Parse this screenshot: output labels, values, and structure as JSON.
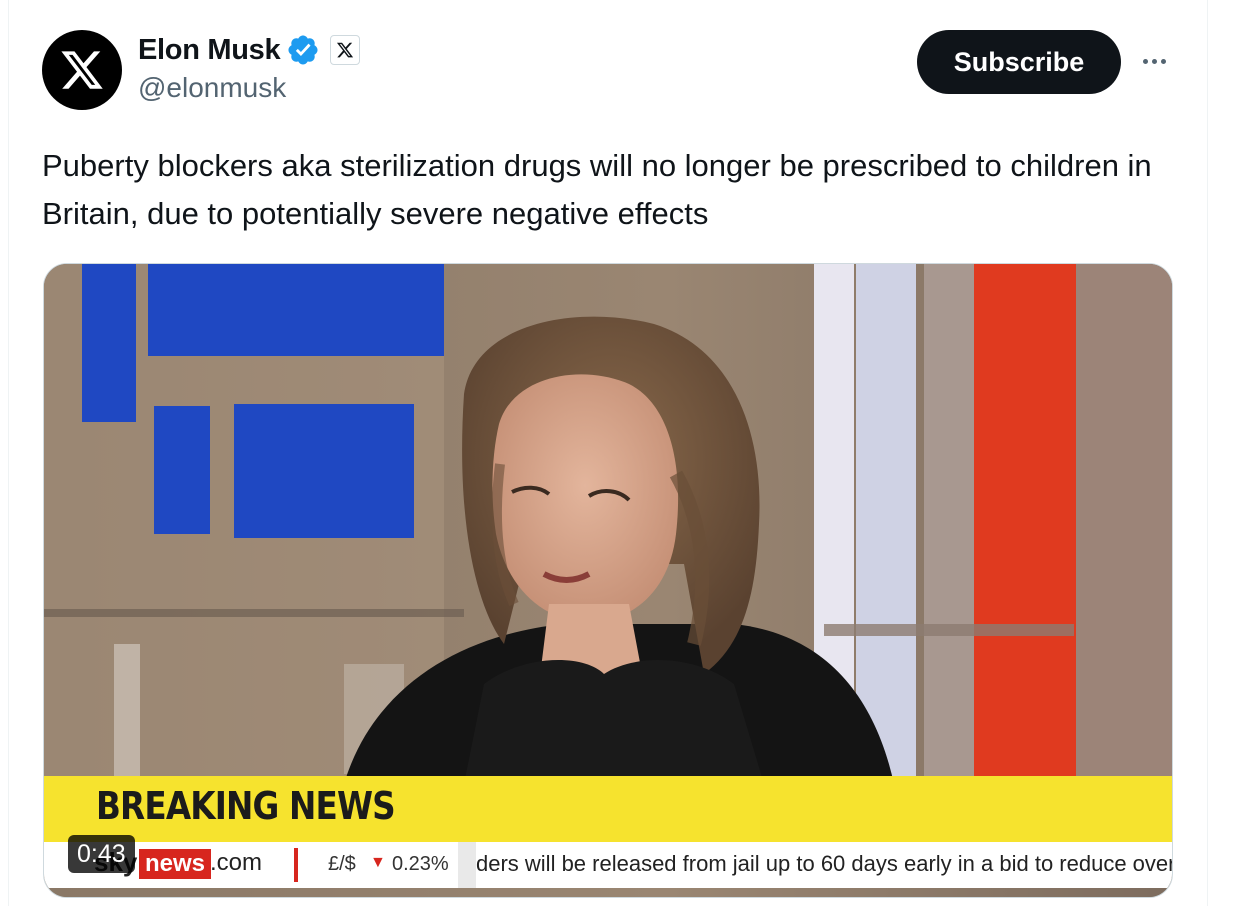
{
  "tweet": {
    "author": {
      "display_name": "Elon Musk",
      "handle": "@elonmusk",
      "avatar_icon": "x-logo-icon",
      "verified_icon": "verified-badge-icon",
      "affiliation_icon": "x-affiliate-badge-icon"
    },
    "subscribe_label": "Subscribe",
    "more_icon": "more-options-icon",
    "text": "Puberty blockers aka sterilization drugs will no longer be prescribed to children in Britain, due to potentially severe negative effects"
  },
  "video": {
    "duration": "0:43",
    "lower_third": {
      "headline": "BREAKING NEWS",
      "brand_sky": "sky",
      "brand_news": "news",
      "brand_com": ".com",
      "fx_label": "£/$",
      "fx_direction": "▼",
      "fx_value": "0.23%",
      "ticker_text": "ders will be released from jail up to 60 days early in a bid to reduce overcrowding"
    }
  },
  "colors": {
    "verified_blue": "#1d9bf0",
    "button_dark": "#0f1419",
    "secondary_text": "#536471",
    "breaking_yellow": "#f6e32e",
    "sky_red": "#d7261e"
  }
}
